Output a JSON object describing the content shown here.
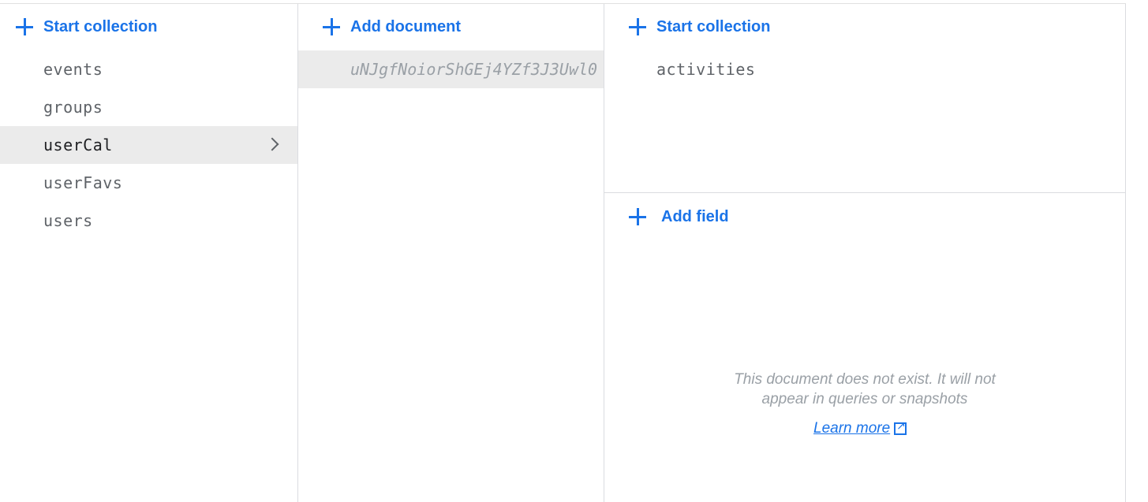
{
  "col1": {
    "action_label": "Start collection",
    "items": [
      "events",
      "groups",
      "userCal",
      "userFavs",
      "users"
    ],
    "selected": "userCal"
  },
  "col2": {
    "action_label": "Add document",
    "doc_id": "uNJgfNoiorShGEj4YZf3J3Uwl0"
  },
  "col3": {
    "collection_action_label": "Start collection",
    "subcollections": [
      "activities"
    ],
    "field_action_label": "Add field",
    "notice_line1": "This document does not exist. It will not",
    "notice_line2": "appear in queries or snapshots",
    "learn_more": "Learn more"
  },
  "colors": {
    "accent": "#1a73e8",
    "selected_bg": "#ebebeb",
    "muted_text": "#9aa0a6"
  }
}
